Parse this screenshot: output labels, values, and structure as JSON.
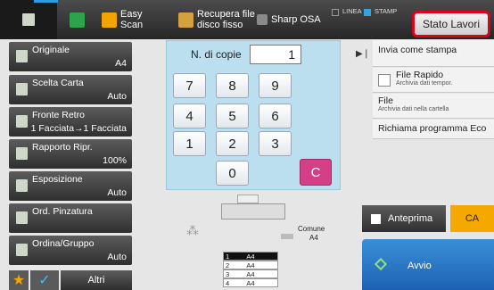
{
  "topbar": {
    "easy_scan": "Easy\nScan",
    "recall_hdd": "Recupera file\ndisco fisso",
    "sharp_osa": "Sharp OSA",
    "line_label": "LINEA",
    "print_label": "STAMP",
    "job_status": "Stato Lavori"
  },
  "copies": {
    "label": "N. di copie",
    "value": "1"
  },
  "keypad": [
    "7",
    "8",
    "9",
    "4",
    "5",
    "6",
    "1",
    "2",
    "3",
    "0",
    "C"
  ],
  "left_menu": [
    {
      "label": "Originale",
      "value": "A4"
    },
    {
      "label": "Scelta Carta",
      "value": "Auto"
    },
    {
      "label": "Fronte Retro",
      "value": "1 Facciata→1 Facciata"
    },
    {
      "label": "Rapporto Ripr.",
      "value": "100%"
    },
    {
      "label": "Esposizione",
      "value": "Auto"
    },
    {
      "label": "Ord. Pinzatura",
      "value": ""
    },
    {
      "label": "Ordina/Gruppo",
      "value": "Auto"
    }
  ],
  "bottom_left": {
    "more": "Altri"
  },
  "right_menu": {
    "send_as_print": "Invia come stampa",
    "quick_file": "File Rapido",
    "quick_file_sub": "Archivia dati tempor.",
    "file": "File",
    "file_sub": "Archivia dati nella cartella",
    "eco": "Richiama programma Eco"
  },
  "actions": {
    "preview": "Anteprima",
    "ca": "CA",
    "start": "Avvio"
  },
  "machine": {
    "output_tray": "Comune",
    "output_size": "A4",
    "trays": [
      {
        "n": "1",
        "size": "A4"
      },
      {
        "n": "2",
        "size": "A4"
      },
      {
        "n": "3",
        "size": "A4"
      },
      {
        "n": "4",
        "size": "A4"
      }
    ]
  }
}
